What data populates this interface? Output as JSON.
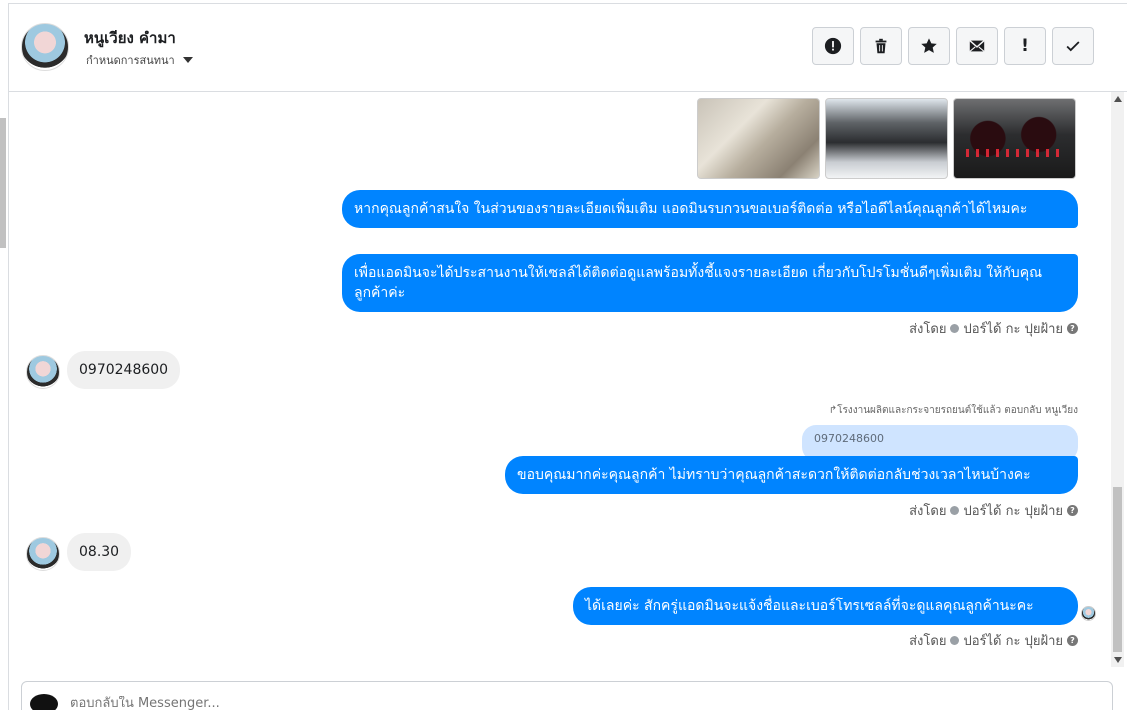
{
  "header": {
    "name": "หนูเวียง คำมา",
    "subtitle": "กำหนดการสนทนา",
    "actions": [
      {
        "icon": "alert-circle-icon"
      },
      {
        "icon": "trash-icon"
      },
      {
        "icon": "star-icon"
      },
      {
        "icon": "mail-icon"
      },
      {
        "icon": "exclamation-icon",
        "label": "!"
      },
      {
        "icon": "checkmark-icon"
      }
    ]
  },
  "messages": {
    "out_1": "หากคุณลูกค้าสนใจ ในส่วนของรายละเอียดเพิ่มเติม แอดมินรบกวนขอเบอร์ติดต่อ หรือไอดีไลน์คุณลูกค้าได้ไหมคะ",
    "out_2": "เพื่อแอดมินจะได้ประสานงานให้เซลล์ได้ติดต่อดูแลพร้อมทั้งชี้แจงรายละเอียด เกี่ยวกับโปรโมชั่นดีๆเพิ่มเติม ให้กับคุณลูกค้าค่ะ",
    "in_1": "0970248600",
    "reply_note": "↱โรงงานผลิตและกระจายรถยนต์ใช้แล้ว ตอบกลับ หนูเวียง",
    "quoted": "0970248600",
    "out_3": "ขอบคุณมากค่ะคุณลูกค้า ไม่ทราบว่าคุณลูกค้าสะดวกให้ติดต่อกลับช่วงเวลาไหนบ้างคะ",
    "in_2": "08.30",
    "out_4": "ได้เลยค่ะ สักครู่แอดมินจะแจ้งชื่อและเบอร์โทรเซลล์ที่จะดูแลคุณลูกค้านะคะ"
  },
  "sent_by": {
    "prefix": "ส่งโดย",
    "name": "ปอร์ได้ กะ ปุยฝ้าย",
    "help": "?"
  },
  "composer": {
    "placeholder": "ตอบกลับใน Messenger..."
  },
  "colors": {
    "outgoing": "#0084ff",
    "incoming": "#f0f0f0",
    "quoted": "#cfe4ff"
  }
}
